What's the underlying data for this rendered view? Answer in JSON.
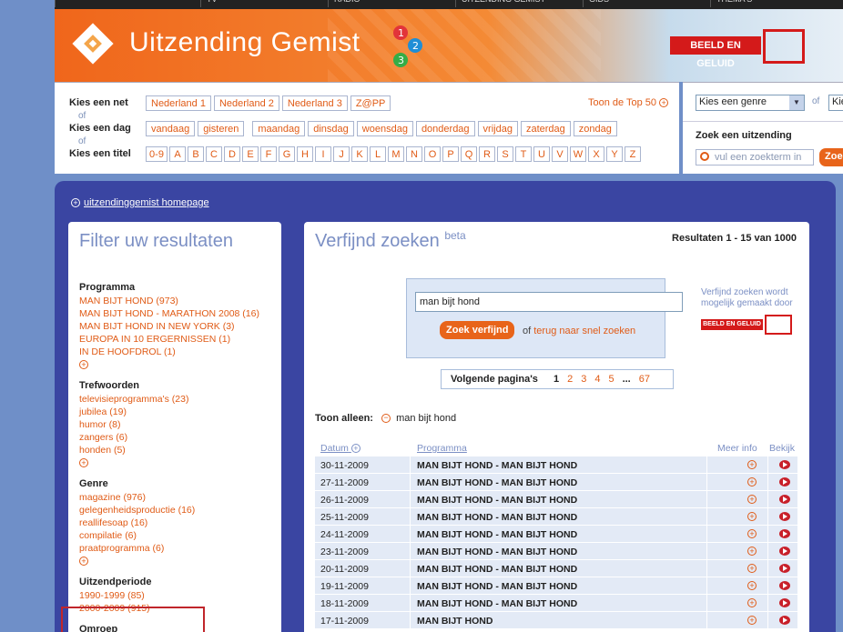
{
  "brand": {
    "title": "Uitzending Gemist",
    "partner": "BEELD EN GELUID"
  },
  "topnav": [
    "",
    "TV",
    "RADIO",
    "UITZENDING GEMIST",
    "GIDS",
    "THEMA'S"
  ],
  "filters": {
    "net_label": "Kies een net",
    "nets": [
      "Nederland 1",
      "Nederland 2",
      "Nederland 3",
      "Z@PP"
    ],
    "of": "of",
    "dag_label": "Kies een dag",
    "days_rel": [
      "vandaag",
      "gisteren"
    ],
    "days": [
      "maandag",
      "dinsdag",
      "woensdag",
      "donderdag",
      "vrijdag",
      "zaterdag",
      "zondag"
    ],
    "titel_label": "Kies een titel",
    "letters": [
      "0-9",
      "A",
      "B",
      "C",
      "D",
      "E",
      "F",
      "G",
      "H",
      "I",
      "J",
      "K",
      "L",
      "M",
      "N",
      "O",
      "P",
      "Q",
      "R",
      "S",
      "T",
      "U",
      "V",
      "W",
      "X",
      "Y",
      "Z"
    ],
    "top50": "Toon de Top 50"
  },
  "rpanel": {
    "genre": "Kies een genre",
    "of": "of",
    "genre2": "Kies",
    "zoek_label": "Zoek een uitzending",
    "placeholder": "vul een zoekterm in",
    "button": "Zoe"
  },
  "home_link": "uitzendinggemist homepage",
  "left": {
    "title": "Filter uw resultaten",
    "sections": [
      {
        "title": "Programma",
        "items": [
          "MAN BIJT HOND (973)",
          "MAN BIJT HOND - MARATHON 2008 (16)",
          "MAN BIJT HOND IN NEW YORK (3)",
          "EUROPA IN 10 ERGERNISSEN (1)",
          "IN DE HOOFDROL (1)"
        ],
        "more": true
      },
      {
        "title": "Trefwoorden",
        "items": [
          "televisieprogramma's (23)",
          "jubilea (19)",
          "humor (8)",
          "zangers (6)",
          "honden (5)"
        ],
        "more": true
      },
      {
        "title": "Genre",
        "items": [
          "magazine (976)",
          "gelegenheidsproductie (16)",
          "reallifesoap (16)",
          "compilatie (6)",
          "praatprogramma (6)"
        ],
        "more": true
      },
      {
        "title": "Uitzendperiode",
        "items": [
          "1990-1999 (85)",
          "2000-2009 (915)"
        ],
        "more": false
      },
      {
        "title": "Omroep",
        "items": [],
        "more": false
      }
    ]
  },
  "right": {
    "title": "Verfijnd zoeken",
    "beta": "beta",
    "results": "Resultaten 1 - 15 van 1000",
    "query": "man bijt hond",
    "refine_button": "Zoek verfijnd",
    "of": "of",
    "back_link": "terug naar snel zoeken",
    "powered": "Verfijnd zoeken wordt mogelijk gemaakt door",
    "pager_label": "Volgende pagina's",
    "pages": [
      "1",
      "2",
      "3",
      "4",
      "5"
    ],
    "dots": "...",
    "last_page": "67",
    "toon_label": "Toon alleen:",
    "toon_value": "man bijt hond",
    "columns": {
      "date": "Datum",
      "program": "Programma",
      "info": "Meer info",
      "watch": "Bekijk"
    },
    "rows": [
      {
        "date": "30-11-2009",
        "program": "MAN BIJT HOND - MAN BIJT HOND"
      },
      {
        "date": "27-11-2009",
        "program": "MAN BIJT HOND - MAN BIJT HOND"
      },
      {
        "date": "26-11-2009",
        "program": "MAN BIJT HOND - MAN BIJT HOND"
      },
      {
        "date": "25-11-2009",
        "program": "MAN BIJT HOND - MAN BIJT HOND"
      },
      {
        "date": "24-11-2009",
        "program": "MAN BIJT HOND - MAN BIJT HOND"
      },
      {
        "date": "23-11-2009",
        "program": "MAN BIJT HOND - MAN BIJT HOND"
      },
      {
        "date": "20-11-2009",
        "program": "MAN BIJT HOND - MAN BIJT HOND"
      },
      {
        "date": "19-11-2009",
        "program": "MAN BIJT HOND - MAN BIJT HOND"
      },
      {
        "date": "18-11-2009",
        "program": "MAN BIJT HOND - MAN BIJT HOND"
      },
      {
        "date": "17-11-2009",
        "program": "MAN BIJT HOND"
      }
    ]
  },
  "colors": {
    "orange": "#e05b16",
    "navy": "#3a45a2",
    "lightblue": "#7b8fc4",
    "red": "#d41a1a"
  }
}
